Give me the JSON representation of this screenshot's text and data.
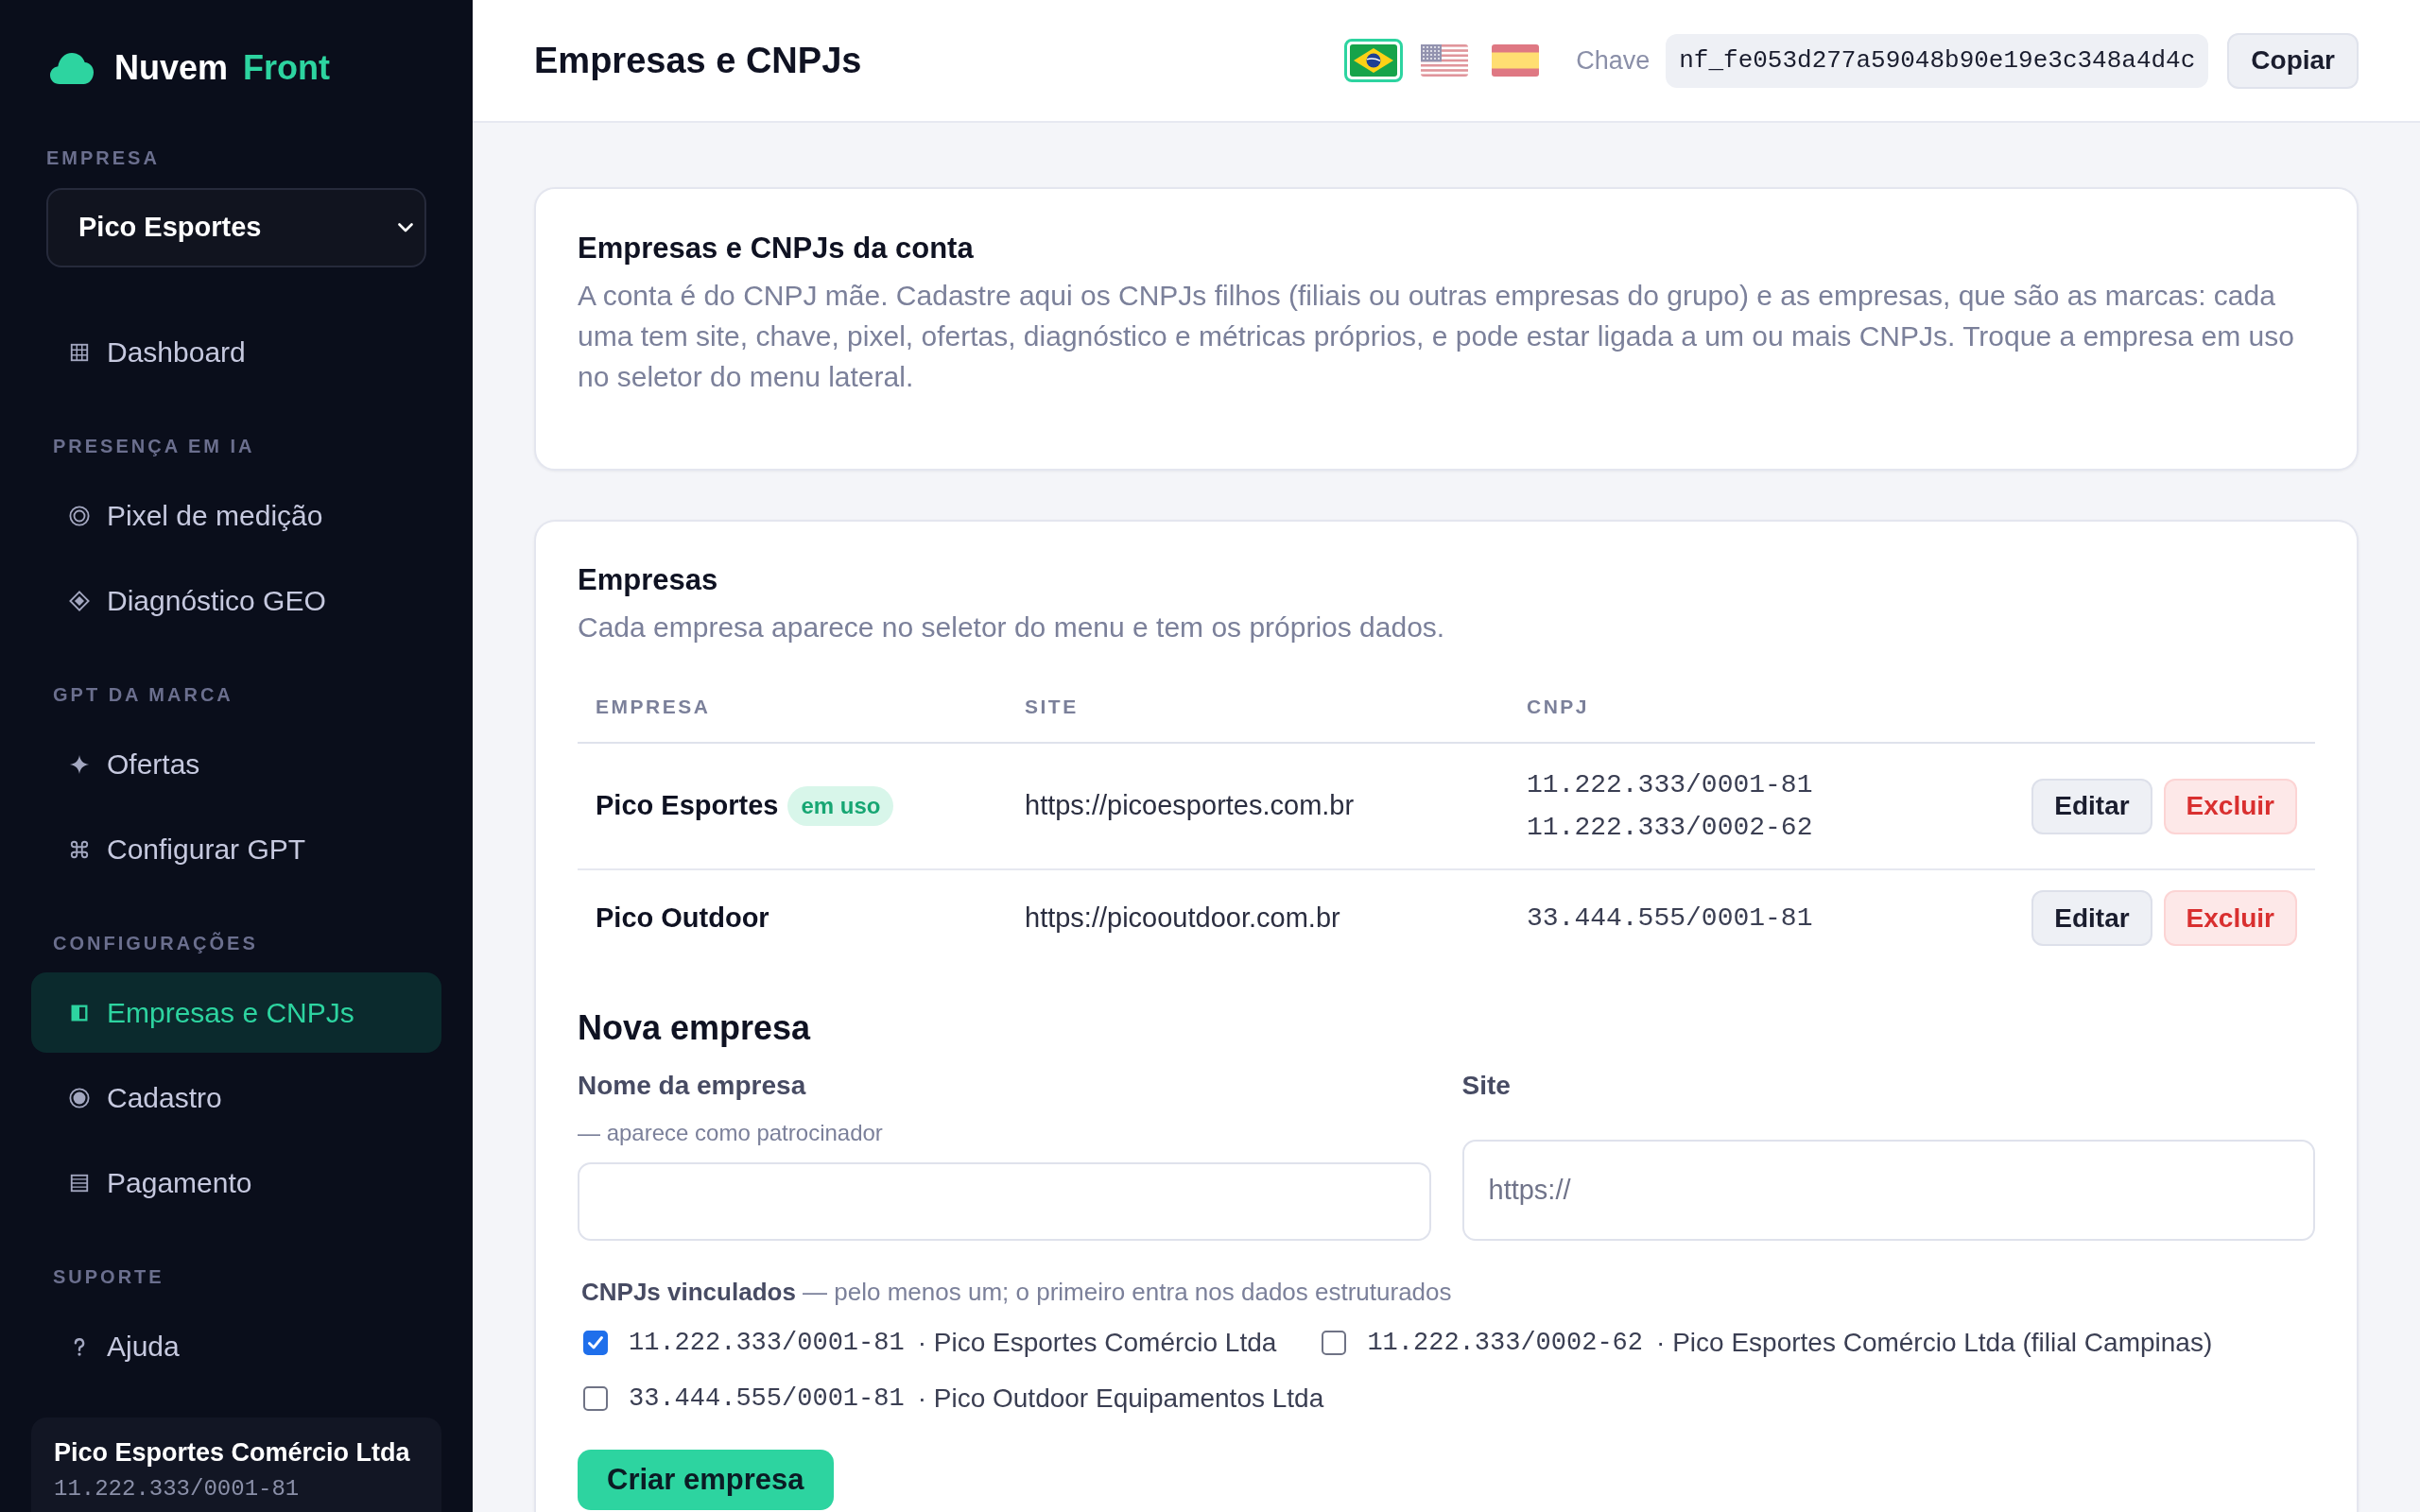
{
  "sidebar": {
    "logo": {
      "name": "Nuvem",
      "accent": "Front"
    },
    "company_label": "EMPRESA",
    "company_select": {
      "value": "Pico Esportes"
    },
    "sections": [
      {
        "items": [
          {
            "label": "Dashboard",
            "selected": false
          }
        ]
      },
      {
        "title": "PRESENÇA EM IA",
        "items": [
          {
            "label": "Pixel de medição",
            "selected": false
          },
          {
            "label": "Diagnóstico GEO",
            "selected": false
          }
        ]
      },
      {
        "title": "GPT DA MARCA",
        "items": [
          {
            "label": "Ofertas",
            "selected": false
          },
          {
            "label": "Configurar GPT",
            "selected": false
          }
        ]
      },
      {
        "title": "CONFIGURAÇÕES",
        "items": [
          {
            "label": "Empresas e CNPJs",
            "selected": true
          },
          {
            "label": "Cadastro",
            "selected": false
          },
          {
            "label": "Pagamento",
            "selected": false
          }
        ]
      },
      {
        "title": "SUPORTE",
        "items": [
          {
            "label": "Ajuda",
            "selected": false
          }
        ]
      }
    ],
    "account_card": {
      "title": "Pico Esportes Comércio Ltda",
      "subtitle": "11.222.333/0001-81"
    }
  },
  "header": {
    "title": "Empresas e CNPJs",
    "languages": [
      {
        "selected": true
      },
      {
        "selected": false
      },
      {
        "selected": false
      }
    ],
    "key_label": "Chave",
    "key_value": "nf_fe053d277a59048b90e19e3c348a4d4c",
    "copy_button": "Copiar"
  },
  "intro_card": {
    "title": "Empresas e CNPJs da conta",
    "text": "A conta é do CNPJ mãe. Cadastre aqui os CNPJs filhos (filiais ou outras empresas do grupo) e as empresas, que são as marcas: cada uma tem site, chave, pixel, ofertas, diagnóstico e métricas próprios, e pode estar ligada a um ou mais CNPJs. Troque a empresa em uso no seletor do menu lateral."
  },
  "companies_card": {
    "title": "Empresas",
    "subtitle": "Cada empresa aparece no seletor do menu e tem os próprios dados.",
    "table": {
      "columns": [
        "EMPRESA",
        "SITE",
        "CNPJ"
      ],
      "rows": [
        {
          "name": "Pico Esportes",
          "badge": "em uso",
          "site": "https://picoesportes.com.br",
          "cnpjs": [
            "11.222.333/0001-81",
            "11.222.333/0002-62"
          ],
          "actions": [
            {
              "label": "Editar",
              "kind": "neutral"
            },
            {
              "label": "Excluir",
              "kind": "danger"
            }
          ]
        },
        {
          "name": "Pico Outdoor",
          "site": "https://picooutdoor.com.br",
          "cnpjs": [
            "33.444.555/0001-81"
          ],
          "actions": [
            {
              "label": "Editar",
              "kind": "neutral"
            },
            {
              "label": "Excluir",
              "kind": "danger"
            }
          ]
        }
      ]
    },
    "new_company": {
      "title": "Nova empresa",
      "fields": [
        {
          "label": "Nome da empresa",
          "hint": "— aparece como patrocinador"
        },
        {
          "label": "Site",
          "placeholder": "https://"
        }
      ],
      "cnpjs_label": "**CNPJs vinculados** — pelo menos um; o primeiro entra nos dados estruturados",
      "cnpjs": [
        {
          "cnpj": "11.222.333/0001-81",
          "name": "· Pico Esportes Comércio Ltda",
          "checked": true
        },
        {
          "cnpj": "11.222.333/0002-62",
          "name": "· Pico Esportes Comércio Ltda (filial Campinas)",
          "checked": false
        },
        {
          "cnpj": "33.444.555/0001-81",
          "name": "· Pico Outdoor Equipamentos Ltda",
          "checked": false
        }
      ],
      "submit_button": "Criar empresa"
    }
  }
}
